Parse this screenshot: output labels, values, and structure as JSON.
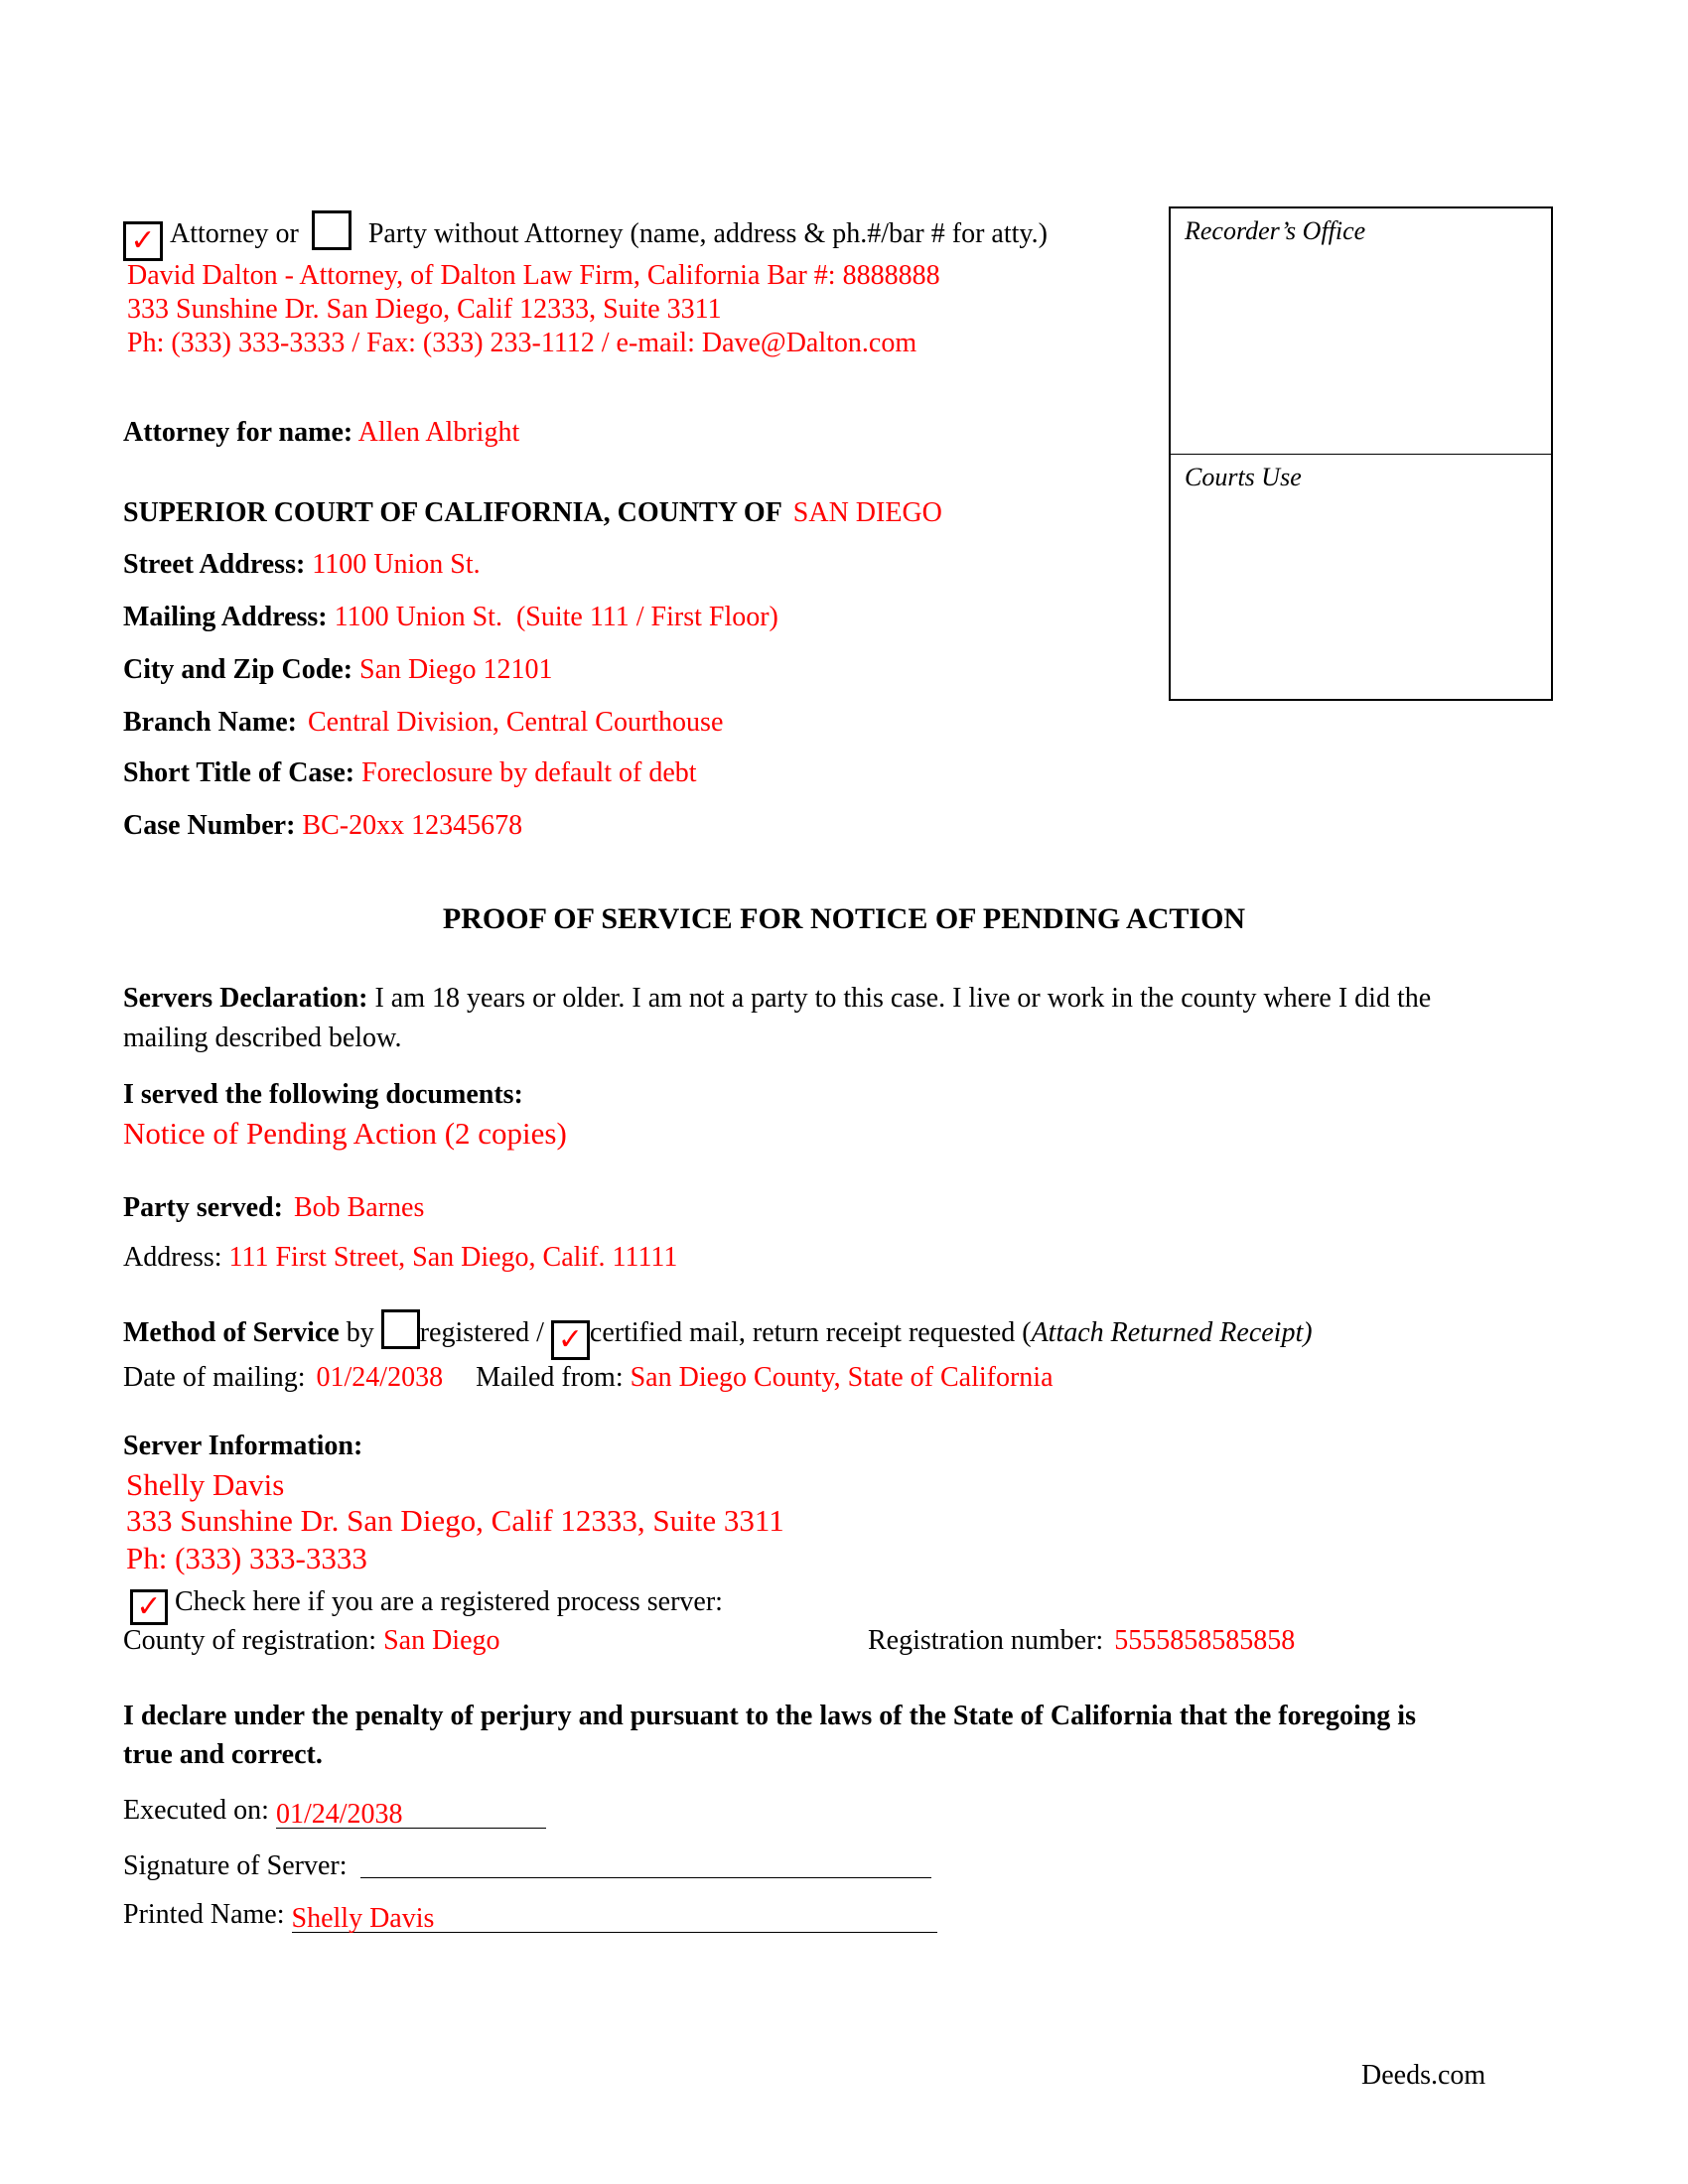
{
  "header": {
    "attorney_checkbox": {
      "label": "Attorney or",
      "checked": true
    },
    "party_checkbox": {
      "label": "Party without Attorney (name, address & ph.#/bar # for atty.)",
      "checked": false
    },
    "attorney_lines": [
      "David Dalton - Attorney, of Dalton Law Firm, California Bar #: 8888888",
      "333 Sunshine Dr. San Diego, Calif 12333, Suite 3311",
      "Ph: (333) 333-3333 / Fax: (333) 233-1112 / e-mail: Dave@Dalton.com"
    ],
    "attorney_for": {
      "label": "Attorney for name:",
      "value": "Allen Albright"
    }
  },
  "side_box": {
    "recorder_label": "Recorder’s Office",
    "courts_label": "Courts Use"
  },
  "court": {
    "heading": "SUPERIOR COURT OF CALIFORNIA, COUNTY OF",
    "county": "SAN DIEGO",
    "fields": [
      {
        "label": "Street Address:",
        "value": "1100 Union St."
      },
      {
        "label": "Mailing Address:",
        "value": "1100 Union St.  (Suite 111 / First Floor)"
      },
      {
        "label": "City and Zip Code:",
        "value": "San Diego 12101"
      },
      {
        "label": "Branch Name:",
        "value": "Central Division, Central Courthouse"
      },
      {
        "label": "Short Title of Case:",
        "value": "Foreclosure by default of debt"
      },
      {
        "label": "Case Number:",
        "value": "BC-20xx 12345678"
      }
    ]
  },
  "document_title": "PROOF OF SERVICE FOR NOTICE OF PENDING ACTION",
  "declaration": {
    "label": "Servers Declaration:",
    "text_line1": "I am 18 years or older. I am not a party to this case. I live or work in the county where I did the",
    "text_line2": "mailing described below."
  },
  "documents": {
    "label": "I served the following documents:",
    "value": "Notice of Pending Action (2 copies)"
  },
  "party": {
    "label": "Party served:",
    "value": "Bob Barnes",
    "address_label": "Address:",
    "address_value": "111 First Street, San Diego, Calif. 11111"
  },
  "method": {
    "label": "Method of Service",
    "by": "by",
    "registered": {
      "label": "registered /",
      "checked": false
    },
    "certified": {
      "label": "certified mail, return receipt requested (",
      "checked": true
    },
    "note": "Attach Returned Receipt)"
  },
  "mailing": {
    "date_label": "Date of mailing:",
    "date_value": "01/24/2038",
    "from_label": "Mailed from:",
    "from_value": "San Diego County, State of California"
  },
  "server": {
    "label": "Server Information:",
    "lines": [
      "Shelly Davis",
      "333 Sunshine Dr. San Diego, Calif 12333, Suite 3311",
      "Ph: (333) 333-3333"
    ],
    "registered_checkbox": {
      "label": "Check here if you are a registered process server:",
      "checked": true
    },
    "county_label": "County of registration:",
    "county_value": "San Diego",
    "reg_label": "Registration number:",
    "reg_value": "5555858585858"
  },
  "perjury": {
    "line1": "I declare under the penalty of perjury and pursuant to the laws of the State of California that the foregoing is",
    "line2": "true and correct."
  },
  "signature": {
    "executed_label": "Executed on:",
    "executed_value": "01/24/2038",
    "signature_label": "Signature of Server:",
    "signature_value": "",
    "printed_label": "Printed Name:",
    "printed_value": "Shelly Davis"
  },
  "footer": {
    "brand": "Deeds.com"
  },
  "icons": {
    "check": "✓"
  },
  "colors": {
    "fill_in": "#ff0000",
    "text": "#000000"
  }
}
